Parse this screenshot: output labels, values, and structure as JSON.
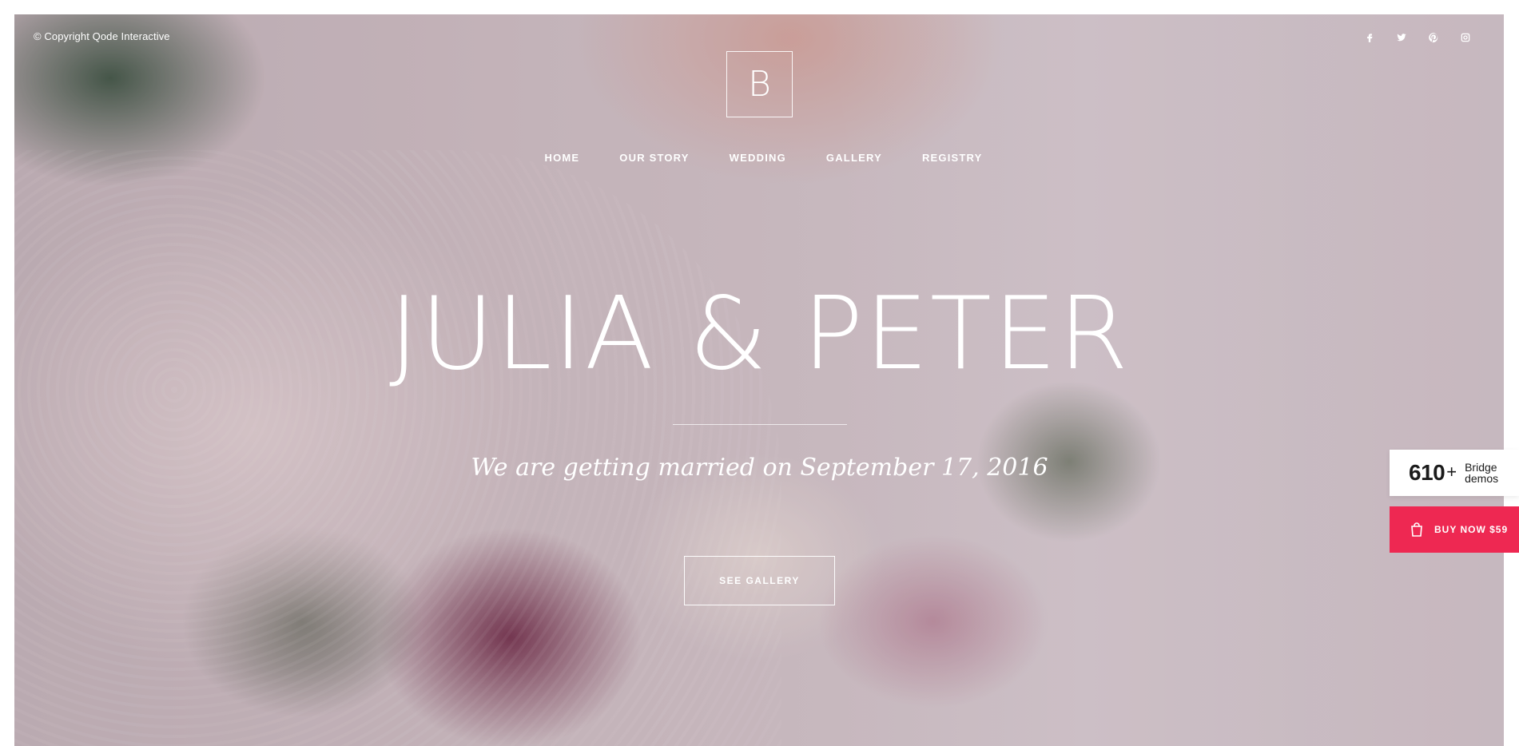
{
  "header": {
    "copyright": "© Copyright Qode Interactive",
    "logo_letter": "B",
    "social": [
      {
        "icon": "facebook-icon"
      },
      {
        "icon": "twitter-icon"
      },
      {
        "icon": "pinterest-icon"
      },
      {
        "icon": "instagram-icon"
      }
    ]
  },
  "nav": {
    "items": [
      {
        "label": "HOME"
      },
      {
        "label": "OUR STORY"
      },
      {
        "label": "WEDDING"
      },
      {
        "label": "GALLERY"
      },
      {
        "label": "REGISTRY"
      }
    ]
  },
  "hero": {
    "title": "JULIA & PETER",
    "subtitle": "We are getting married on September 17, 2016",
    "button_label": "SEE GALLERY"
  },
  "promo": {
    "count": "610",
    "plus": "+",
    "line1": "Bridge",
    "line2": "demos",
    "buy_label": "BUY NOW $59",
    "buy_icon": "shopping-bag-icon",
    "accent_color": "#ee2852"
  }
}
